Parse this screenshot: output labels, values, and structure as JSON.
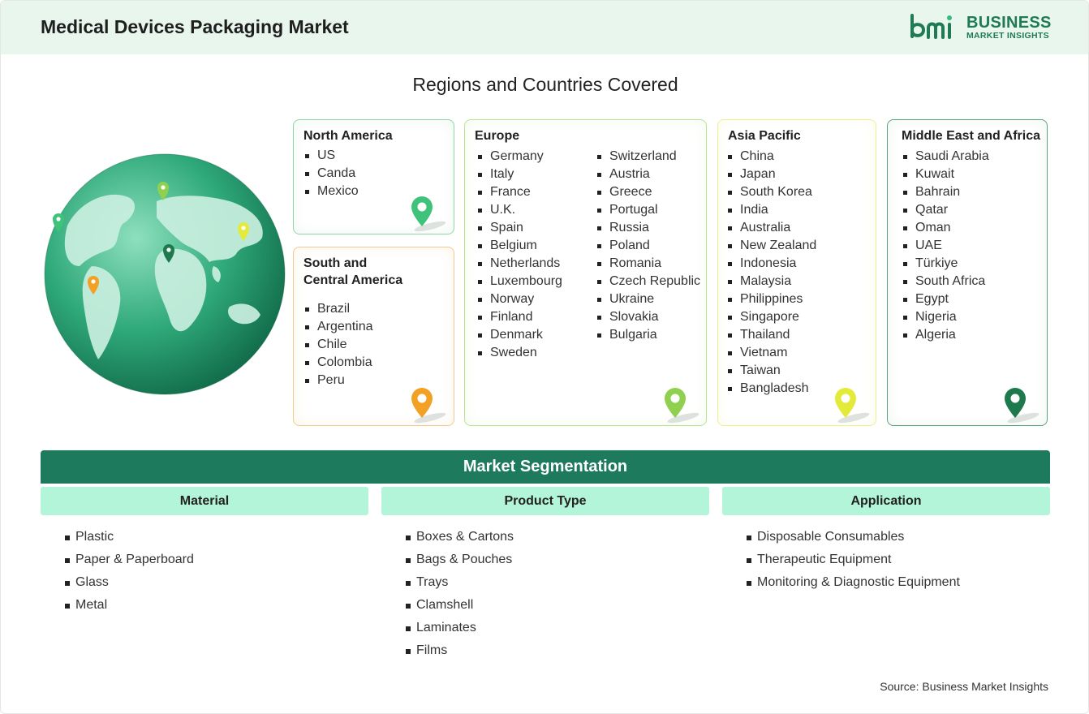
{
  "header": {
    "title": "Medical Devices Packaging Market",
    "logo_line1": "BUSINESS",
    "logo_line2": "MARKET INSIGHTS"
  },
  "regions_title": "Regions and Countries Covered",
  "regions": {
    "north_america": {
      "title": "North America",
      "countries": [
        "US",
        "Canda",
        "Mexico"
      ],
      "pin_color": "#3fc27a"
    },
    "south_central_america": {
      "title_line1": "South and",
      "title_line2": "Central America",
      "countries": [
        "Brazil",
        "Argentina",
        "Chile",
        "Colombia",
        "Peru"
      ],
      "pin_color": "#f2a124"
    },
    "europe": {
      "title": "Europe",
      "countries_col1": [
        "Germany",
        "Italy",
        "France",
        "U.K.",
        "Spain",
        "Belgium",
        "Netherlands",
        "Luxembourg",
        "Norway",
        "Finland",
        "Denmark",
        "Sweden"
      ],
      "countries_col2": [
        "Switzerland",
        "Austria",
        "Greece",
        "Portugal",
        "Russia",
        "Poland",
        "Romania",
        "Czech Republic",
        "Ukraine",
        "Slovakia",
        "Bulgaria"
      ],
      "pin_color": "#8fd14f"
    },
    "asia_pacific": {
      "title": "Asia Pacific",
      "countries": [
        "China",
        "Japan",
        "South Korea",
        "India",
        "Australia",
        "New Zealand",
        "Indonesia",
        "Malaysia",
        "Philippines",
        "Singapore",
        "Thailand",
        "Vietnam",
        "Taiwan",
        "Bangladesh"
      ],
      "pin_color": "#e3ea3a"
    },
    "middle_east_africa": {
      "title": "Middle East and Africa",
      "countries": [
        "Saudi Arabia",
        "Kuwait",
        "Bahrain",
        "Qatar",
        "Oman",
        "UAE",
        "Türkiye",
        "South Africa",
        "Egypt",
        "Nigeria",
        "Algeria"
      ],
      "pin_color": "#1e7a4c"
    }
  },
  "segmentation": {
    "title": "Market Segmentation",
    "columns": [
      {
        "heading": "Material",
        "items": [
          "Plastic",
          "Paper & Paperboard",
          "Glass",
          "Metal"
        ]
      },
      {
        "heading": "Product Type",
        "items": [
          "Boxes & Cartons",
          "Bags & Pouches",
          "Trays",
          "Clamshell",
          "Laminates",
          "Films"
        ]
      },
      {
        "heading": "Application",
        "items": [
          "Disposable Consumables",
          "Therapeutic Equipment",
          "Monitoring & Diagnostic Equipment"
        ]
      }
    ]
  },
  "source": "Source: Business Market Insights",
  "colors": {
    "brand_green": "#1e7a5c",
    "header_bg": "#e8f6ee",
    "segment_header_bg": "#b3f5d8"
  }
}
